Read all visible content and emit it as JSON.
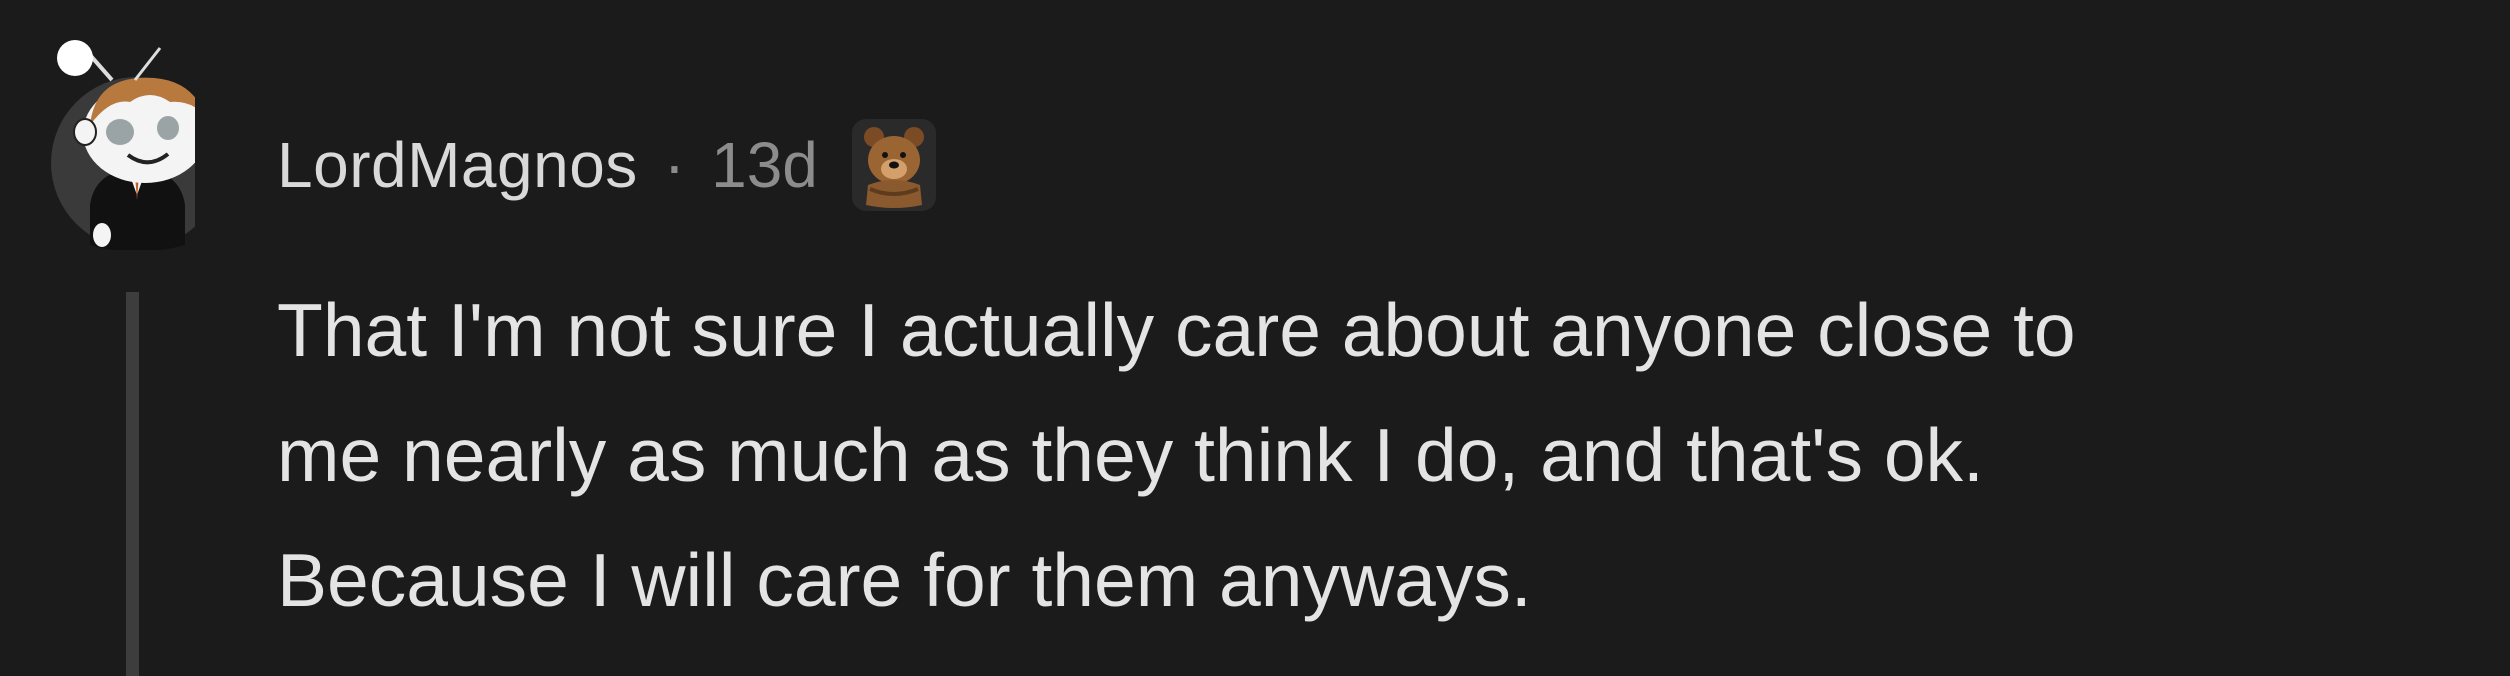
{
  "comment": {
    "author": "LordMagnos",
    "separator": "·",
    "age": "13d",
    "flair_icon": "bear-flair-icon",
    "avatar_icon": "snoo-avatar-icon",
    "body_lines": [
      "That I'm not sure I actually care about anyone close to",
      "me nearly as much as they think I do, and that's ok.",
      "Because I will care for them anyways."
    ]
  },
  "colors": {
    "background": "#1b1b1b",
    "text": "#e4e4e4",
    "muted": "#8c8c8c",
    "thread_line": "#3d3d3d"
  }
}
